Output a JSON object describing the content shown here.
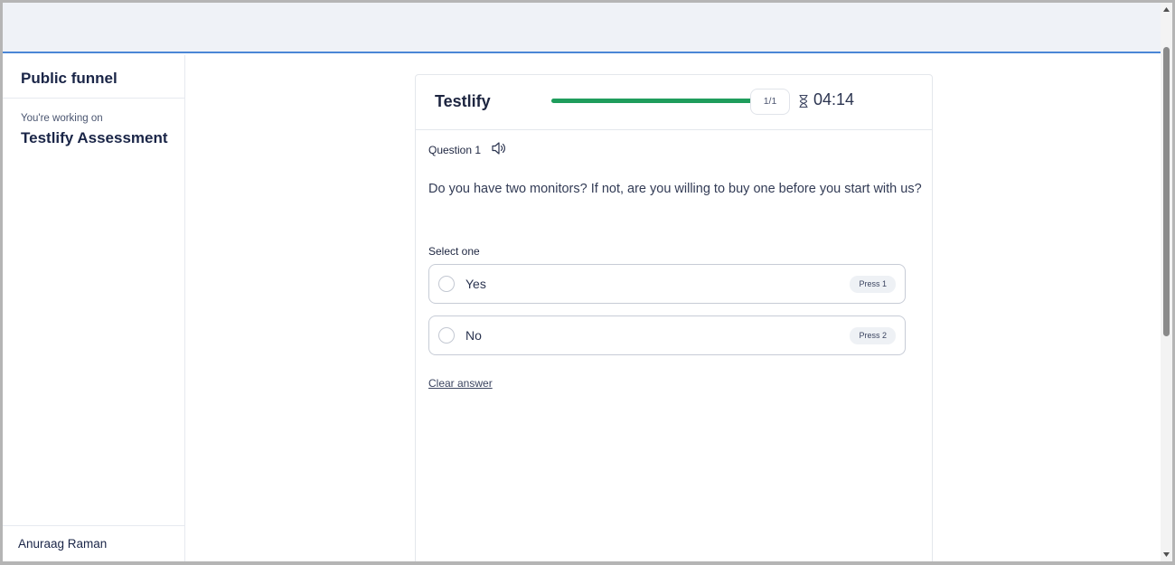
{
  "sidebar": {
    "title": "Public funnel",
    "working_on_label": "You're working on",
    "assessment_name": "Testlify Assessment",
    "user_name": "Anuraag Raman"
  },
  "card": {
    "brand": "Testlify",
    "progress": {
      "count_label": "1/1",
      "fraction": 1.0,
      "color": "#1f9d5c"
    },
    "timer": {
      "icon": "hourglass-icon",
      "value": "04:14"
    },
    "question": {
      "label": "Question 1",
      "audio_icon": "speaker-icon",
      "text": "Do you have two monitors? If not, are you willing to buy one before you start with us?"
    },
    "select_label": "Select one",
    "options": [
      {
        "label": "Yes",
        "shortcut": "Press 1"
      },
      {
        "label": "No",
        "shortcut": "Press 2"
      }
    ],
    "clear_answer": "Clear answer"
  },
  "colors": {
    "accent_line": "#4a86d6",
    "topbar_bg": "#eff2f7",
    "text_primary": "#1a2547"
  }
}
